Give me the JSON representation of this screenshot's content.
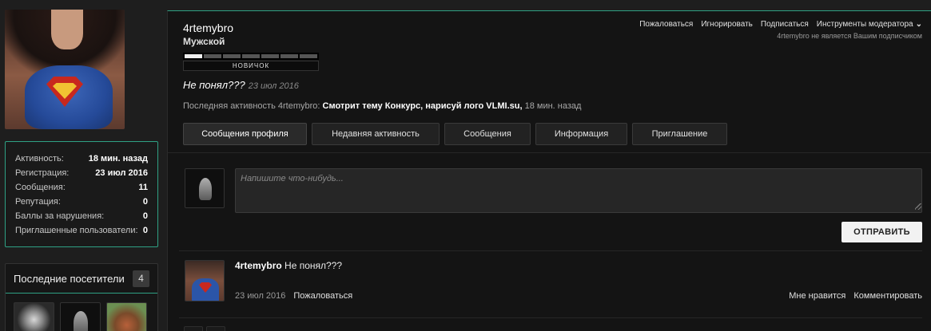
{
  "sidebar": {
    "info": [
      {
        "label": "Активность:",
        "value": "18 мин. назад"
      },
      {
        "label": "Регистрация:",
        "value": "23 июл 2016"
      },
      {
        "label": "Сообщения:",
        "value": "11"
      },
      {
        "label": "Репутация:",
        "value": "0"
      },
      {
        "label": "Баллы за нарушения:",
        "value": "0"
      },
      {
        "label": "Приглашенные пользователи:",
        "value": "0"
      }
    ],
    "visitors": {
      "title": "Последние посетители",
      "count": "4"
    }
  },
  "profile": {
    "username": "4rtemybro",
    "gender": "Мужской",
    "rank_label": "НОВИЧОК",
    "rank_level": 1,
    "rank_total": 7,
    "status_text": "Не понял???",
    "status_date": "23 июл 2016",
    "activity_prefix": "Последняя активность 4rtemybro:",
    "activity_action": "Смотрит тему Конкурс, нарисуй лого VLMI.su,",
    "activity_time": "18 мин. назад"
  },
  "actions": {
    "report": "Пожаловаться",
    "ignore": "Игнорировать",
    "subscribe": "Подписаться",
    "moderator_tools": "Инструменты модератора",
    "subscriber_note": "4rtemybro не является Вашим подписчиком"
  },
  "tabs": [
    {
      "label": "Сообщения профиля",
      "active": true
    },
    {
      "label": "Недавняя активность",
      "active": false
    },
    {
      "label": "Сообщения",
      "active": false
    },
    {
      "label": "Информация",
      "active": false
    },
    {
      "label": "Приглашение",
      "active": false
    }
  ],
  "compose": {
    "placeholder": "Напишите что-нибудь...",
    "send_label": "ОТПРАВИТЬ"
  },
  "post": {
    "author": "4rtemybro",
    "text": "Не понял???",
    "date": "23 июл 2016",
    "report": "Пожаловаться",
    "like": "Мне нравится",
    "comment": "Комментировать"
  },
  "colors": {
    "accent": "#2fa184",
    "panel": "#141414",
    "background": "#1e1e1e"
  }
}
